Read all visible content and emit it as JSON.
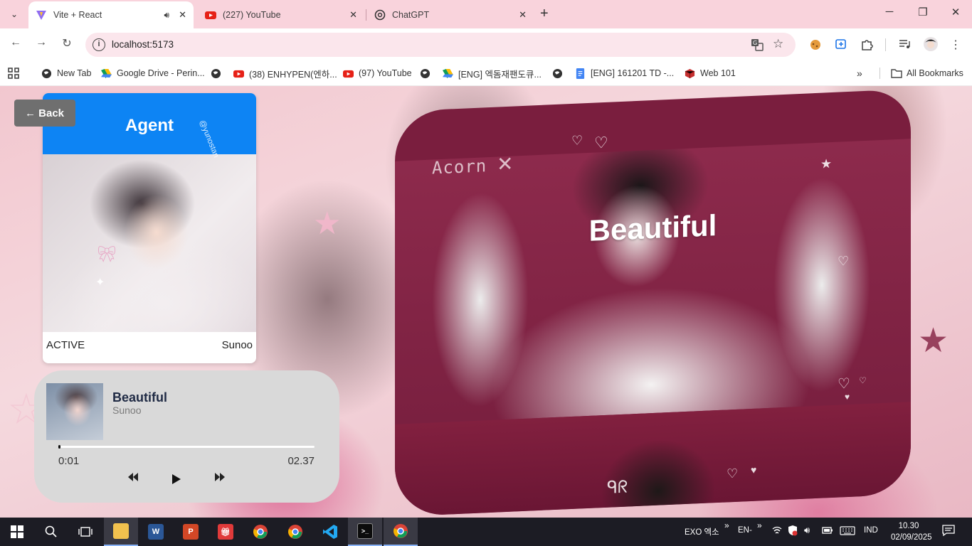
{
  "browser": {
    "tabs": [
      {
        "title": "Vite + React",
        "favicon": "vite-icon",
        "active": true,
        "audio": true
      },
      {
        "title": "(227) YouTube",
        "favicon": "youtube-icon",
        "active": false
      },
      {
        "title": "ChatGPT",
        "favicon": "chatgpt-icon",
        "active": false
      }
    ],
    "url": "localhost:5173",
    "bookmarks": [
      {
        "label": "New Tab",
        "icon": "globe-icon"
      },
      {
        "label": "Google Drive - Perin...",
        "icon": "drive-icon"
      },
      {
        "label": "(38) ENHYPEN(엔하...",
        "icon": "youtube-icon"
      },
      {
        "label": "(97) YouTube",
        "icon": "youtube-icon"
      },
      {
        "label": "[ENG] 엑돔재팬도큐...",
        "icon": "drive-icon"
      },
      {
        "label": "[ENG] 161201 TD -...",
        "icon": "docs-icon"
      },
      {
        "label": "Web 101",
        "icon": "cube-icon"
      }
    ],
    "all_bookmarks": "All Bookmarks"
  },
  "page": {
    "back_label": "← Back",
    "agent": {
      "title": "Agent",
      "watermark": "@yunostan",
      "status": "ACTIVE",
      "name": "Sunoo"
    },
    "player": {
      "title": "Beautiful",
      "artist": "Sunoo",
      "current_time": "0:01",
      "duration": "02.37",
      "progress": 0.007
    },
    "hero": {
      "title": "Beautiful",
      "acorn_text": "Acorn",
      "signature": "ᑫᖇ"
    }
  },
  "taskbar": {
    "tray": {
      "ime": "EXO 엑소",
      "lang_short": "EN-",
      "lang": "IND",
      "time": "10.30",
      "date": "02/09/2025"
    }
  },
  "colors": {
    "agent_header": "#0d84f4",
    "tabbar": "#f9d3dc",
    "hero_bg": "#7a1e3e"
  }
}
